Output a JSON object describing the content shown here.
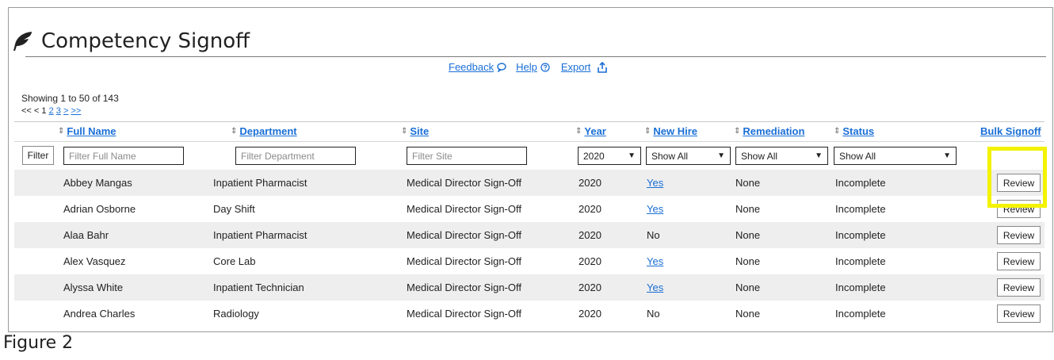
{
  "page": {
    "title": "Competency Signoff",
    "title_icon": "feather-icon",
    "figure_caption": "Figure 2"
  },
  "toplinks": {
    "feedback": "Feedback",
    "feedback_icon": "speech-bubble-icon",
    "help": "Help",
    "help_icon": "help-circle-icon",
    "export": "Export",
    "export_icon": "export-icon"
  },
  "summary": {
    "showing": "Showing 1 to 50 of 143",
    "pager_prefix": "<< < 1",
    "pager_links": [
      "2",
      "3",
      ">",
      ">>"
    ]
  },
  "columns": {
    "full_name": "Full Name",
    "department": "Department",
    "site": "Site",
    "year": "Year",
    "new_hire": "New Hire",
    "remediation": "Remediation",
    "status": "Status",
    "bulk_signoff": "Bulk Signoff"
  },
  "filters": {
    "button": "Filter",
    "full_name_placeholder": "Filter Full Name",
    "department_placeholder": "Filter Department",
    "site_placeholder": "Filter Site",
    "year_value": "2020",
    "new_hire_value": "Show All",
    "remediation_value": "Show All",
    "status_value": "Show All"
  },
  "rows": [
    {
      "name": "Abbey Mangas",
      "department": "Inpatient Pharmacist",
      "site": "Medical Director Sign-Off",
      "year": "2020",
      "new_hire": "Yes",
      "remediation": "None",
      "status": "Incomplete",
      "action": "Review"
    },
    {
      "name": "Adrian Osborne",
      "department": "Day Shift",
      "site": "Medical Director Sign-Off",
      "year": "2020",
      "new_hire": "Yes",
      "remediation": "None",
      "status": "Incomplete",
      "action": "Review"
    },
    {
      "name": "Alaa Bahr",
      "department": "Inpatient Pharmacist",
      "site": "Medical Director Sign-Off",
      "year": "2020",
      "new_hire": "No",
      "remediation": "None",
      "status": "Incomplete",
      "action": "Review"
    },
    {
      "name": "Alex Vasquez",
      "department": "Core Lab",
      "site": "Medical Director Sign-Off",
      "year": "2020",
      "new_hire": "Yes",
      "remediation": "None",
      "status": "Incomplete",
      "action": "Review"
    },
    {
      "name": "Alyssa White",
      "department": "Inpatient Technician",
      "site": "Medical Director Sign-Off",
      "year": "2020",
      "new_hire": "Yes",
      "remediation": "None",
      "status": "Incomplete",
      "action": "Review"
    },
    {
      "name": "Andrea Charles",
      "department": "Radiology",
      "site": "Medical Director Sign-Off",
      "year": "2020",
      "new_hire": "No",
      "remediation": "None",
      "status": "Incomplete",
      "action": "Review"
    }
  ],
  "colors": {
    "link": "#1a6fd6",
    "highlight": "#f3f300",
    "row_alt": "#eeeeee"
  }
}
